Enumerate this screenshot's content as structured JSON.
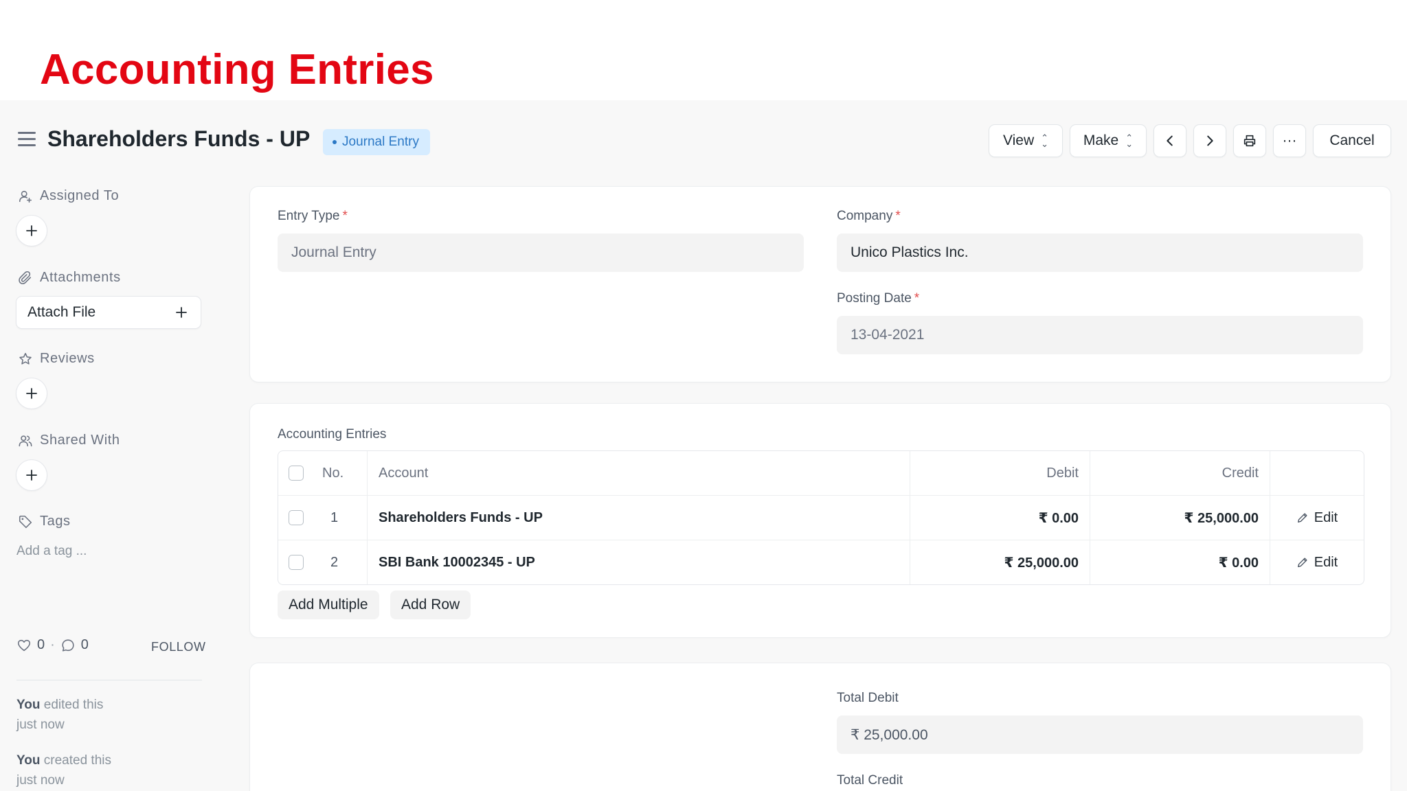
{
  "slide": {
    "title": "Accounting Entries"
  },
  "page": {
    "title": "Shareholders Funds - UP",
    "status": "Journal Entry",
    "toolbar": {
      "view": "View",
      "make": "Make",
      "cancel": "Cancel",
      "more": "···"
    }
  },
  "sidebar": {
    "assigned_to": "Assigned To",
    "attachments": "Attachments",
    "attach_file": "Attach File",
    "reviews": "Reviews",
    "shared_with": "Shared With",
    "tags": "Tags",
    "add_tag": "Add a tag ...",
    "likes": "0",
    "comments": "0",
    "follow": "FOLLOW",
    "activity": [
      {
        "who": "You",
        "what": " edited this",
        "when": "just now"
      },
      {
        "who": "You",
        "what": " created this",
        "when": "just now"
      }
    ]
  },
  "form": {
    "entry_type": {
      "label": "Entry Type",
      "value": "Journal Entry"
    },
    "company": {
      "label": "Company",
      "value": "Unico Plastics Inc."
    },
    "posting_date": {
      "label": "Posting Date",
      "value": "13-04-2021"
    }
  },
  "entries": {
    "section_label": "Accounting Entries",
    "headers": {
      "no": "No.",
      "account": "Account",
      "debit": "Debit",
      "credit": "Credit"
    },
    "rows": [
      {
        "no": "1",
        "account": "Shareholders Funds - UP",
        "debit": "₹ 0.00",
        "credit": "₹ 25,000.00",
        "action": "Edit"
      },
      {
        "no": "2",
        "account": "SBI Bank 10002345 - UP",
        "debit": "₹ 25,000.00",
        "credit": "₹ 0.00",
        "action": "Edit"
      }
    ],
    "add_multiple": "Add Multiple",
    "add_row": "Add Row"
  },
  "totals": {
    "total_debit": {
      "label": "Total Debit",
      "value": "₹ 25,000.00"
    },
    "total_credit": {
      "label": "Total Credit"
    }
  },
  "colors": {
    "slide_title": "#e30613",
    "status_bg": "#d6ecff",
    "status_text": "#2b78c5",
    "required": "#e24c4c"
  }
}
